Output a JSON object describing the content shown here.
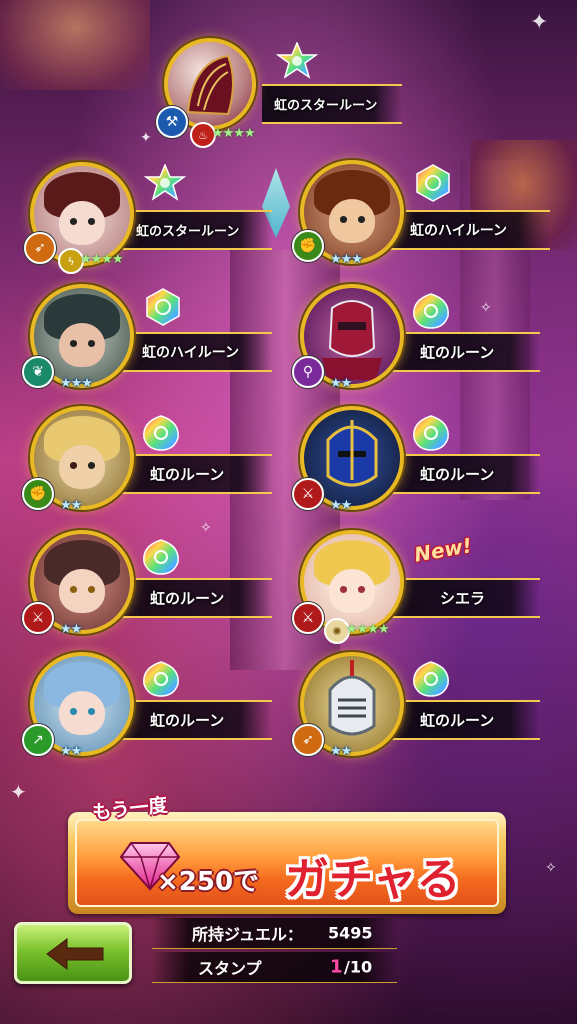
{
  "pulls": [
    {
      "name": "虹のスタールーン",
      "class_icon": "axe-icon",
      "element_icon": "fire-icon",
      "stars": "★★★★",
      "rune": "rainbow-star-rune"
    },
    {
      "name": "虹のスタールーン",
      "class_icon": "bow-icon",
      "element_icon": "lightning-icon",
      "stars": "★★★★",
      "rune": "rainbow-star-rune"
    },
    {
      "name": "虹のハイルーン",
      "class_icon": "fist-icon",
      "element_icon": "",
      "stars": "★★★",
      "rune": "rainbow-high-rune"
    },
    {
      "name": "虹のハイルーン",
      "class_icon": "wing-icon",
      "element_icon": "",
      "stars": "★★★",
      "rune": "rainbow-high-rune"
    },
    {
      "name": "虹のルーン",
      "class_icon": "staff-icon",
      "element_icon": "",
      "stars": "★★",
      "rune": "rainbow-rune"
    },
    {
      "name": "虹のルーン",
      "class_icon": "fist-icon",
      "element_icon": "",
      "stars": "★★",
      "rune": "rainbow-rune"
    },
    {
      "name": "虹のルーン",
      "class_icon": "sword-icon",
      "element_icon": "",
      "stars": "★★",
      "rune": "rainbow-rune"
    },
    {
      "name": "虹のルーン",
      "class_icon": "sword-icon",
      "element_icon": "",
      "stars": "★★",
      "rune": "rainbow-rune"
    },
    {
      "name": "シエラ",
      "class_icon": "sword-icon",
      "element_icon": "light-icon",
      "stars": "★★★★",
      "rune": ""
    },
    {
      "name": "虹のルーン",
      "class_icon": "spear-icon",
      "element_icon": "",
      "stars": "★★",
      "rune": "rainbow-rune"
    },
    {
      "name": "虹のルーン",
      "class_icon": "bow-icon",
      "element_icon": "",
      "stars": "★★",
      "rune": "rainbow-rune"
    }
  ],
  "new_badge": "New!",
  "gacha": {
    "again_label": "もう一度",
    "cost": "×250で",
    "action": "ガチャる",
    "currency_icon": "jewel-icon"
  },
  "jewels": {
    "label": "所持ジュエル：",
    "value": "5495"
  },
  "stamps": {
    "label": "スタンプ",
    "current": "1",
    "total": "/10"
  },
  "back_icon": "back-arrow-icon",
  "colors": {
    "gold": "#e8b923",
    "button_orange": "#f46a1e",
    "gacha_red": "#e0212f",
    "back_green": "#7cc22c"
  }
}
